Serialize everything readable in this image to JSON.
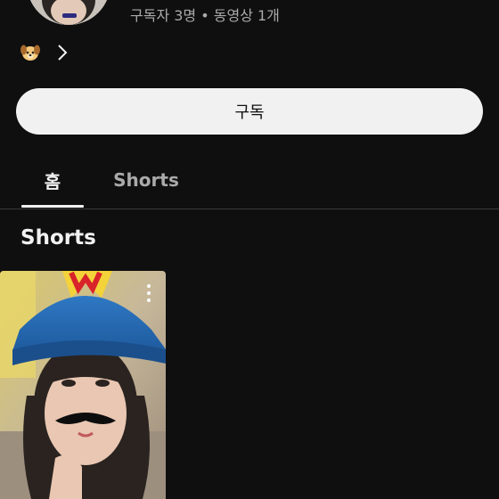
{
  "channel": {
    "stats": "구독자 3명 • 동영상 1개",
    "link_emoji_icon": "dog-face-icon"
  },
  "subscribe_label": "구독",
  "tabs": [
    {
      "label": "홈",
      "active": true
    },
    {
      "label": "Shorts",
      "active": false
    }
  ],
  "section_title": "Shorts",
  "colors": {
    "background": "#0f0f0f",
    "button_bg": "#f1f1f1",
    "secondary_text": "#aaaaaa"
  }
}
